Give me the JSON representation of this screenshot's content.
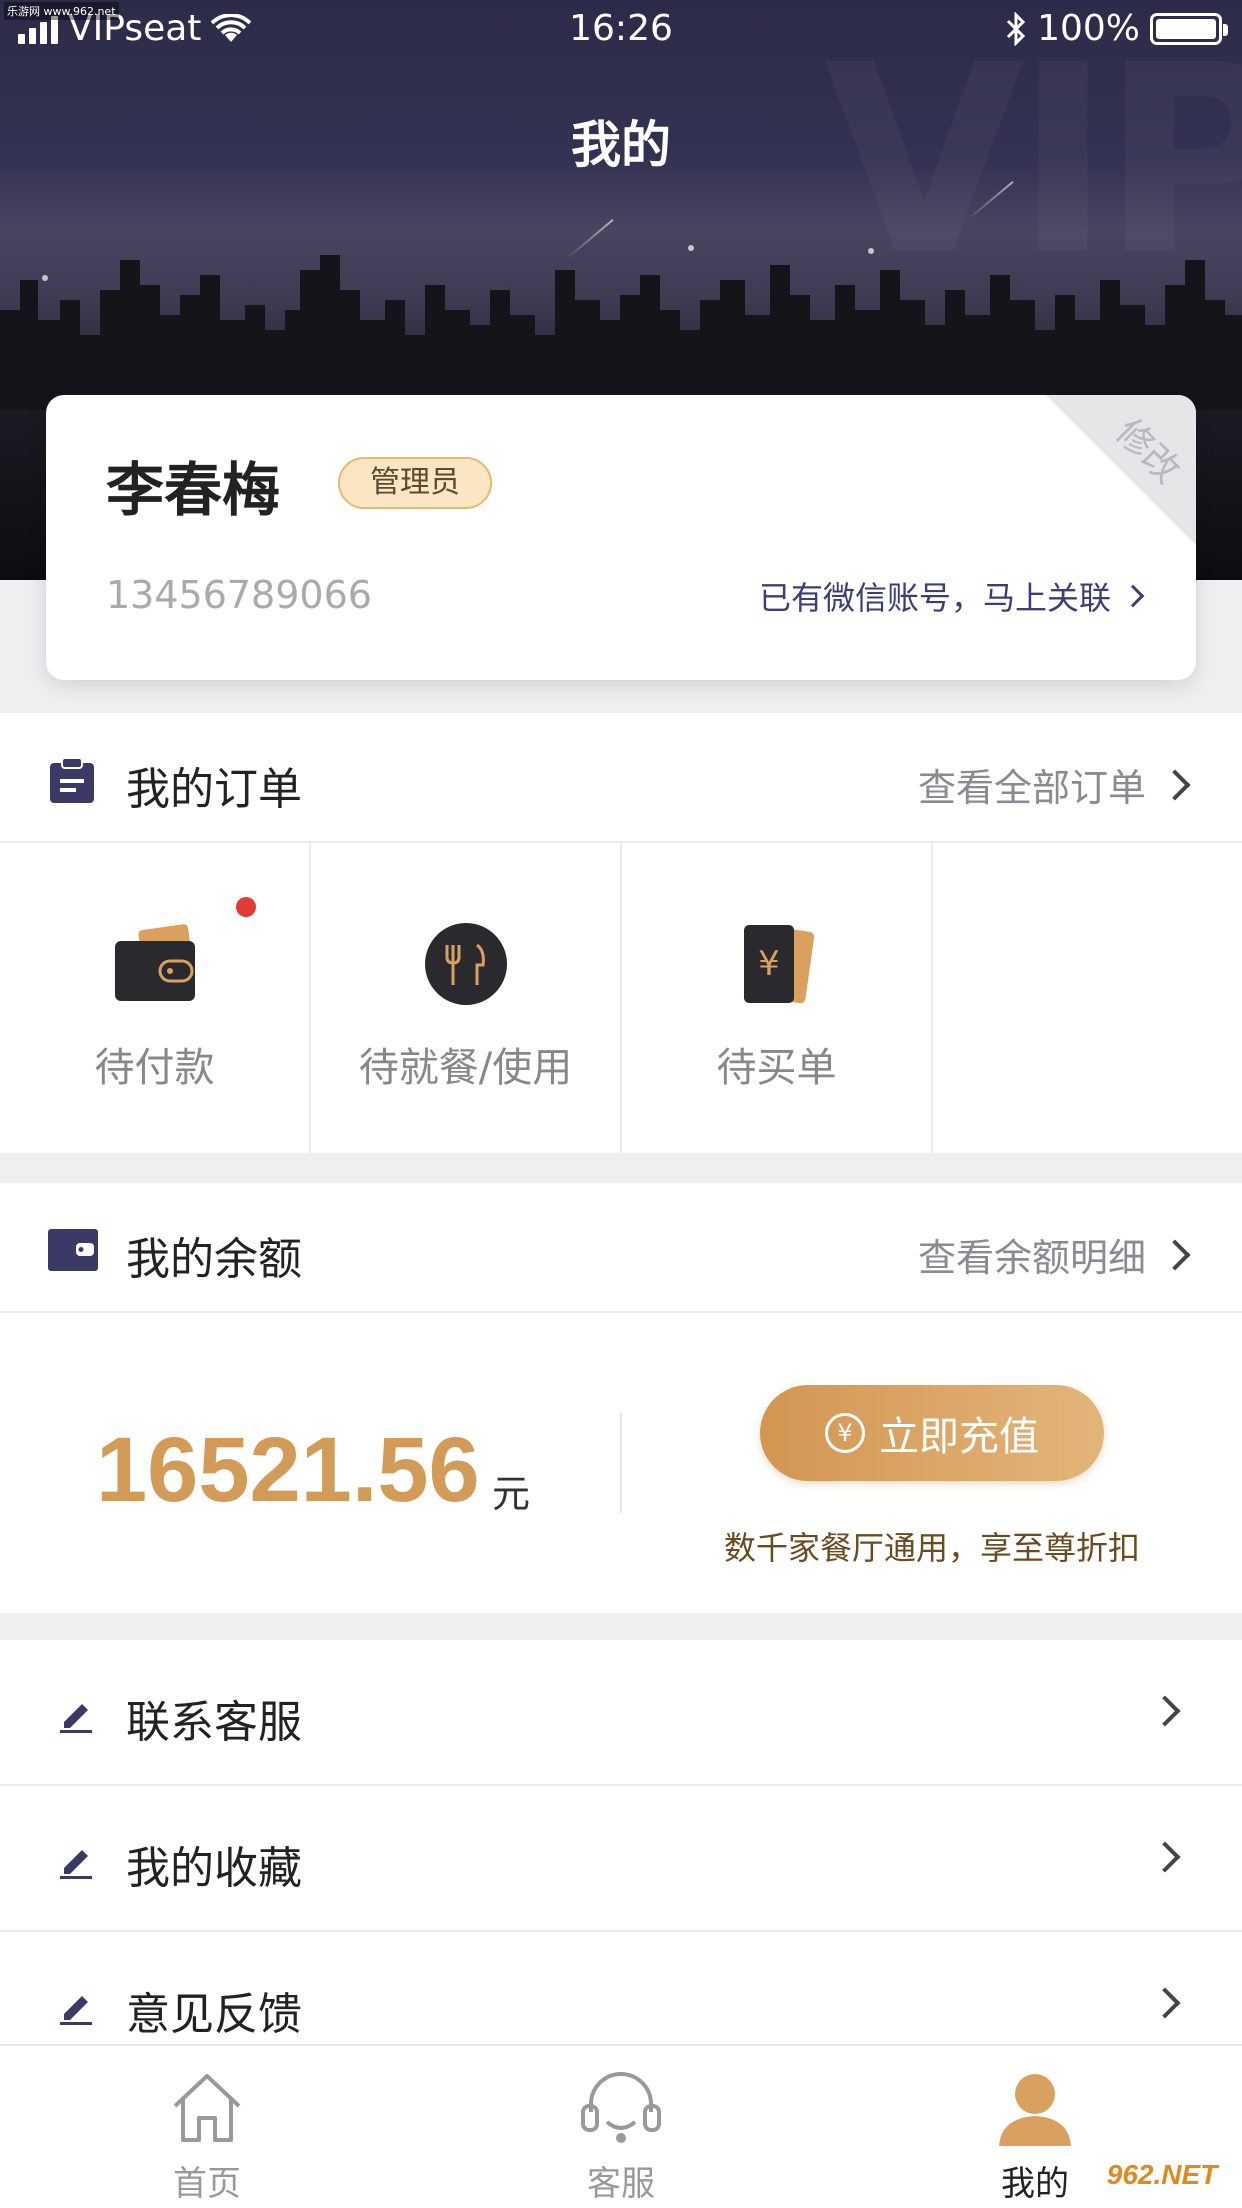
{
  "status_bar": {
    "carrier": "VIPseat",
    "time": "16:26",
    "battery": "100%"
  },
  "watermark_top": "乐游网 www.962.net",
  "page_title": "我的",
  "profile": {
    "name": "李春梅",
    "role": "管理员",
    "edit_label": "修改",
    "phone": "13456789066",
    "wechat_link": "已有微信账号，马上关联"
  },
  "orders": {
    "title": "我的订单",
    "view_all": "查看全部订单",
    "items": [
      {
        "label": "待付款",
        "icon": "wallet-icon",
        "has_dot": true
      },
      {
        "label": "待就餐/使用",
        "icon": "fork-knife-icon"
      },
      {
        "label": "待买单",
        "icon": "yen-card-icon"
      },
      {
        "label": ""
      }
    ]
  },
  "balance": {
    "title": "我的余额",
    "view_detail": "查看余额明细",
    "amount": "16521.56",
    "unit": "元",
    "recharge_label": "立即充值",
    "note": "数千家餐厅通用，享至尊折扣"
  },
  "menu": [
    {
      "label": "联系客服",
      "icon": "pencil-icon"
    },
    {
      "label": "我的收藏",
      "icon": "pencil-icon"
    },
    {
      "label": "意见反馈",
      "icon": "pencil-icon"
    }
  ],
  "tabs": [
    {
      "label": "首页",
      "icon": "home-icon"
    },
    {
      "label": "客服",
      "icon": "headset-icon"
    },
    {
      "label": "我的",
      "icon": "user-icon",
      "active": true
    }
  ],
  "watermark_logo": "962.NET",
  "colors": {
    "accent_gold": "#d29b57",
    "header_navy": "#2c2b49",
    "link_navy": "#3b3f75",
    "red_dot": "#e23a35"
  }
}
